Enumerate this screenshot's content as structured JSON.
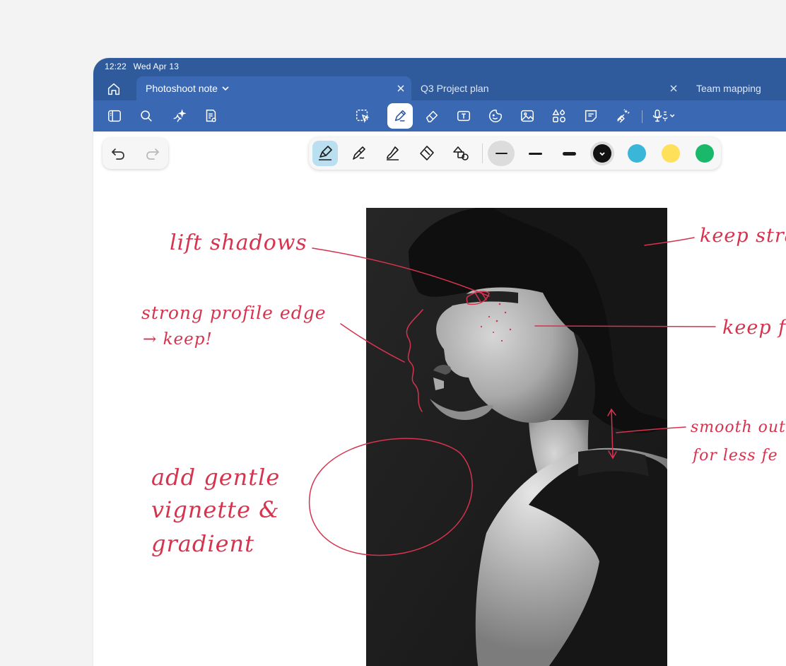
{
  "status_bar": {
    "time": "12:22",
    "date": "Wed Apr 13"
  },
  "tabs": [
    {
      "label": "Photoshoot note",
      "active": true
    },
    {
      "label": "Q3 Project plan",
      "active": false
    },
    {
      "label": "Team mapping",
      "active": false
    }
  ],
  "main_toolbar": {
    "left_icons": [
      "sidebar-icon",
      "search-icon",
      "ai-sparkle-icon",
      "note-settings-icon"
    ],
    "center_icons": [
      "lasso-select-icon",
      "pen-icon",
      "eraser-icon",
      "text-box-icon",
      "sticker-icon",
      "image-icon",
      "shapes-icon",
      "sticky-note-icon",
      "laser-pointer-icon",
      "microphone-icon"
    ],
    "selected": "pen-icon"
  },
  "pen_toolbar": {
    "tools": [
      "fountain-pen-icon",
      "ball-pen-icon",
      "brush-pen-icon",
      "highlighter-icon",
      "shape-pen-icon"
    ],
    "selected_tool": "fountain-pen-icon",
    "thickness_selected": 0,
    "colors": [
      "#111111",
      "#3ab7d8",
      "#ffe05a",
      "#19b86a"
    ],
    "selected_color": "#111111"
  },
  "annotations": {
    "lift_shadows": "lift shadows",
    "profile_edge_1": "strong profile edge",
    "profile_edge_2": "→ keep!",
    "vignette_1": "add gentle",
    "vignette_2": "vignette &",
    "vignette_3": "gradient",
    "keep_strands": "keep stran",
    "keep_freckles": "keep f",
    "smooth_1": "smooth out g",
    "smooth_2": "for less fe"
  },
  "colors": {
    "chrome": "#2f5a9c",
    "toolbar": "#3a68b2",
    "ink": "#d6334e"
  }
}
